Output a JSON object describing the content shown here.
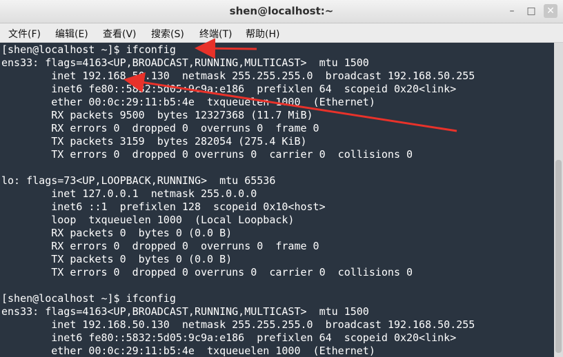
{
  "window": {
    "title": "shen@localhost:~",
    "minimize_label": "–",
    "maximize_label": "□",
    "close_label": "✕"
  },
  "menu": {
    "items": [
      "文件(F)",
      "编辑(E)",
      "查看(V)",
      "搜索(S)",
      "终端(T)",
      "帮助(H)"
    ]
  },
  "terminal": {
    "lines": [
      "[shen@localhost ~]$ ifconfig",
      "ens33: flags=4163<UP,BROADCAST,RUNNING,MULTICAST>  mtu 1500",
      "        inet 192.168.50.130  netmask 255.255.255.0  broadcast 192.168.50.255",
      "        inet6 fe80::5832:5d05:9c9a:e186  prefixlen 64  scopeid 0x20<link>",
      "        ether 00:0c:29:11:b5:4e  txqueuelen 1000  (Ethernet)",
      "        RX packets 9500  bytes 12327368 (11.7 MiB)",
      "        RX errors 0  dropped 0  overruns 0  frame 0",
      "        TX packets 3159  bytes 282054 (275.4 KiB)",
      "        TX errors 0  dropped 0 overruns 0  carrier 0  collisions 0",
      "",
      "lo: flags=73<UP,LOOPBACK,RUNNING>  mtu 65536",
      "        inet 127.0.0.1  netmask 255.0.0.0",
      "        inet6 ::1  prefixlen 128  scopeid 0x10<host>",
      "        loop  txqueuelen 1000  (Local Loopback)",
      "        RX packets 0  bytes 0 (0.0 B)",
      "        RX errors 0  dropped 0  overruns 0  frame 0",
      "        TX packets 0  bytes 0 (0.0 B)",
      "        TX errors 0  dropped 0 overruns 0  carrier 0  collisions 0",
      "",
      "[shen@localhost ~]$ ifconfig",
      "ens33: flags=4163<UP,BROADCAST,RUNNING,MULTICAST>  mtu 1500",
      "        inet 192.168.50.130  netmask 255.255.255.0  broadcast 192.168.50.255",
      "        inet6 fe80::5832:5d05:9c9a:e186  prefixlen 64  scopeid 0x20<link>",
      "        ether 00:0c:29:11:b5:4e  txqueuelen 1000  (Ethernet)"
    ]
  },
  "colors": {
    "terminal_bg": "#2a3440",
    "terminal_fg": "#ffffff",
    "annotation": "#e8322a"
  }
}
